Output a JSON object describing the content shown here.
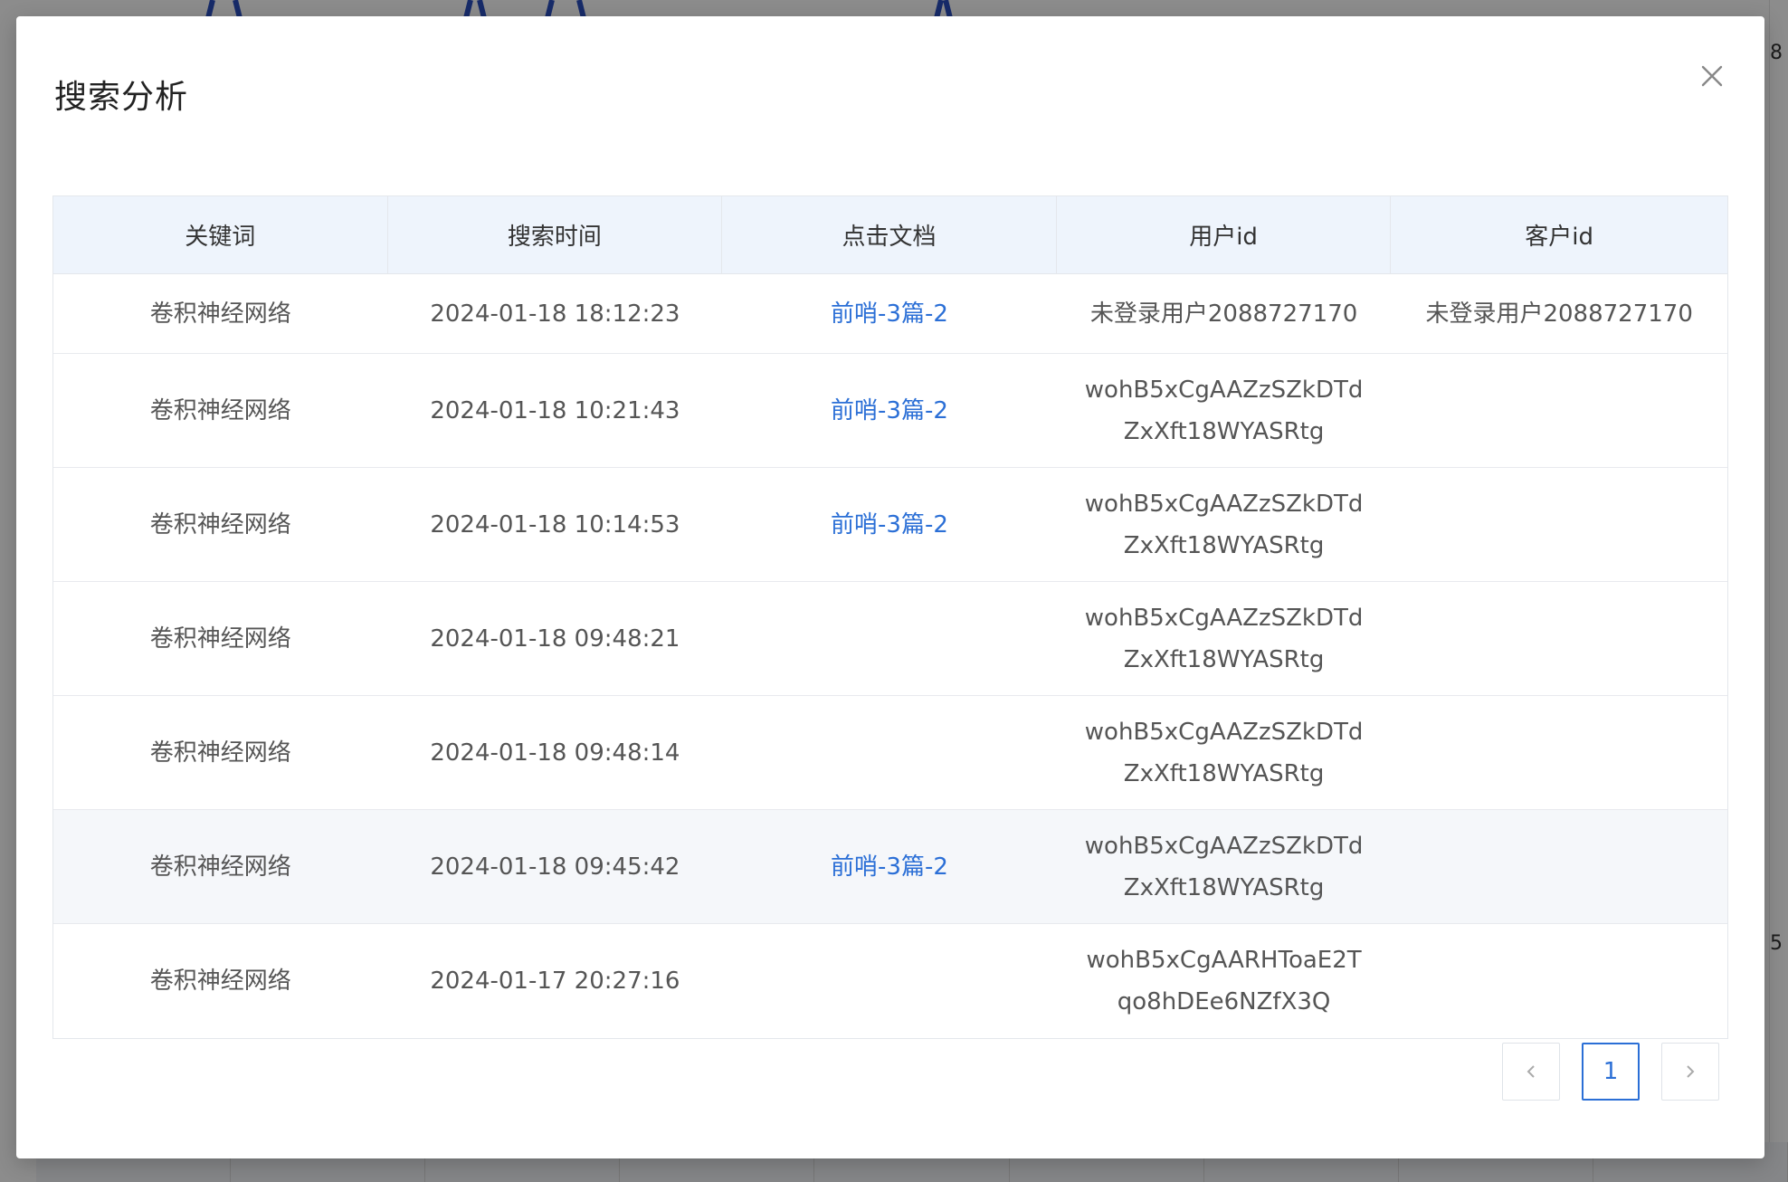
{
  "modal": {
    "title": "搜索分析"
  },
  "table": {
    "columns": [
      "关键词",
      "搜索时间",
      "点击文档",
      "用户id",
      "客户id"
    ],
    "rows": [
      {
        "keyword": "卷积神经网络",
        "time": "2024-01-18 18:12:23",
        "doc": "前哨-3篇-2",
        "user_id": "未登录用户2088727170",
        "customer_id": "未登录用户2088727170"
      },
      {
        "keyword": "卷积神经网络",
        "time": "2024-01-18 10:21:43",
        "doc": "前哨-3篇-2",
        "user_id": "wohB5xCgAAZzSZkDTd\nZxXft18WYASRtg",
        "customer_id": ""
      },
      {
        "keyword": "卷积神经网络",
        "time": "2024-01-18 10:14:53",
        "doc": "前哨-3篇-2",
        "user_id": "wohB5xCgAAZzSZkDTd\nZxXft18WYASRtg",
        "customer_id": ""
      },
      {
        "keyword": "卷积神经网络",
        "time": "2024-01-18 09:48:21",
        "doc": "",
        "user_id": "wohB5xCgAAZzSZkDTd\nZxXft18WYASRtg",
        "customer_id": ""
      },
      {
        "keyword": "卷积神经网络",
        "time": "2024-01-18 09:48:14",
        "doc": "",
        "user_id": "wohB5xCgAAZzSZkDTd\nZxXft18WYASRtg",
        "customer_id": ""
      },
      {
        "keyword": "卷积神经网络",
        "time": "2024-01-18 09:45:42",
        "doc": "前哨-3篇-2",
        "user_id": "wohB5xCgAAZzSZkDTd\nZxXft18WYASRtg",
        "customer_id": ""
      },
      {
        "keyword": "卷积神经网络",
        "time": "2024-01-17 20:27:16",
        "doc": "",
        "user_id": "wohB5xCgAARHToaE2T\nqo8hDEe6NZfX3Q",
        "customer_id": ""
      }
    ]
  },
  "pagination": {
    "current_page": "1",
    "prev_icon": "chevron-left-icon",
    "next_icon": "chevron-right-icon"
  },
  "background": {
    "right_numbers": [
      "8",
      "5"
    ]
  },
  "colors": {
    "accent": "#2b6fd6",
    "header_bg": "#eef4fc",
    "overlay": "rgba(0,0,0,0.45)"
  }
}
